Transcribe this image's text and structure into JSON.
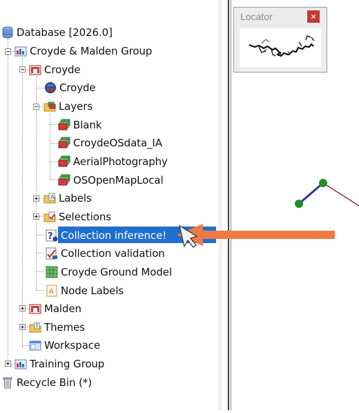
{
  "tree": {
    "items": [
      {
        "label": "Database [2026.0]",
        "icon": "database-icon"
      },
      {
        "label": "Croyde & Malden Group",
        "icon": "model-group-icon"
      },
      {
        "label": "Croyde",
        "icon": "model-network-icon"
      },
      {
        "label": "Croyde",
        "icon": "network-globe-icon"
      },
      {
        "label": "Layers",
        "icon": "layers-folder-icon"
      },
      {
        "label": "Blank",
        "icon": "layer-icon"
      },
      {
        "label": "CroydeOSdata_IA",
        "icon": "layer-icon"
      },
      {
        "label": "AerialPhotography",
        "icon": "layer-icon"
      },
      {
        "label": "OSOpenMapLocal",
        "icon": "layer-icon"
      },
      {
        "label": "Labels",
        "icon": "labels-folder-icon"
      },
      {
        "label": "Selections",
        "icon": "selections-folder-icon"
      },
      {
        "label": "Collection inference!",
        "icon": "inference-icon"
      },
      {
        "label": "Collection validation",
        "icon": "validation-icon"
      },
      {
        "label": "Croyde Ground Model",
        "icon": "ground-model-icon"
      },
      {
        "label": "Node Labels",
        "icon": "node-labels-icon"
      },
      {
        "label": "Malden",
        "icon": "model-network-icon"
      },
      {
        "label": "Themes",
        "icon": "themes-folder-icon"
      },
      {
        "label": "Workspace",
        "icon": "workspace-icon"
      },
      {
        "label": "Training Group",
        "icon": "model-group-icon"
      },
      {
        "label": "Recycle Bin (*)",
        "icon": "recycle-bin-icon"
      }
    ]
  },
  "locator": {
    "title": "Locator",
    "close_symbol": "×"
  },
  "colors": {
    "selection": "#1f6fd1",
    "arrow": "#ef7a42",
    "link": "#2b2fae",
    "node": "#1f8f2a"
  }
}
